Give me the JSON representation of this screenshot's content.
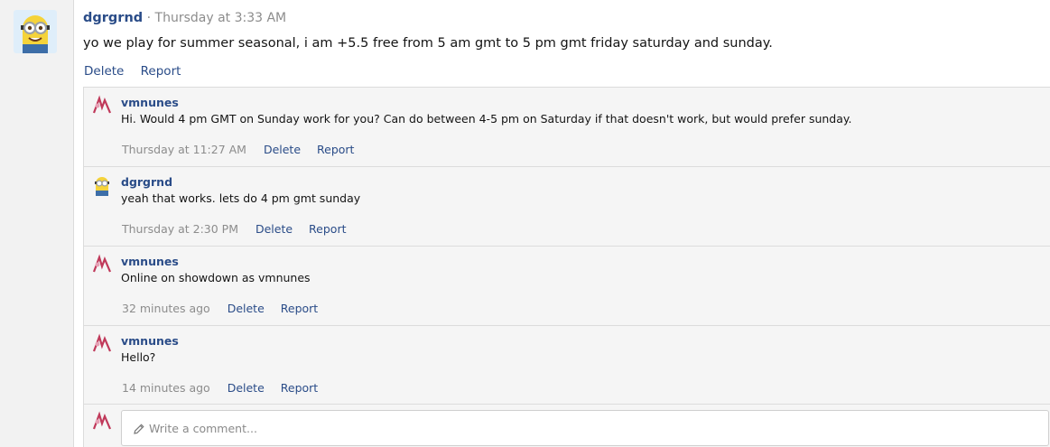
{
  "post": {
    "author": "dgrgrnd",
    "separator": "·",
    "time": "Thursday at 3:33 AM",
    "body": "yo we play for summer seasonal, i am +5.5 free from 5 am gmt to 5 pm gmt friday saturday and sunday.",
    "delete_label": "Delete",
    "report_label": "Report"
  },
  "replies": [
    {
      "author": "vmnunes",
      "text": "Hi. Would 4 pm GMT on Sunday work for you? Can do between 4-5 pm on Saturday if that doesn't work, but would prefer sunday.",
      "time": "Thursday at 11:27 AM",
      "delete_label": "Delete",
      "report_label": "Report"
    },
    {
      "author": "dgrgrnd",
      "text": "yeah that works. lets do 4 pm gmt sunday",
      "time": "Thursday at 2:30 PM",
      "delete_label": "Delete",
      "report_label": "Report"
    },
    {
      "author": "vmnunes",
      "text": "Online on showdown as vmnunes",
      "time": "32 minutes ago",
      "delete_label": "Delete",
      "report_label": "Report"
    },
    {
      "author": "vmnunes",
      "text": "Hello?",
      "time": "14 minutes ago",
      "delete_label": "Delete",
      "report_label": "Report"
    }
  ],
  "comment": {
    "placeholder": "Write a comment..."
  },
  "colors": {
    "link": "#2a4c88",
    "muted": "#8c8c8c",
    "reply_bg": "#f5f5f5",
    "border": "#dcdcdc"
  }
}
